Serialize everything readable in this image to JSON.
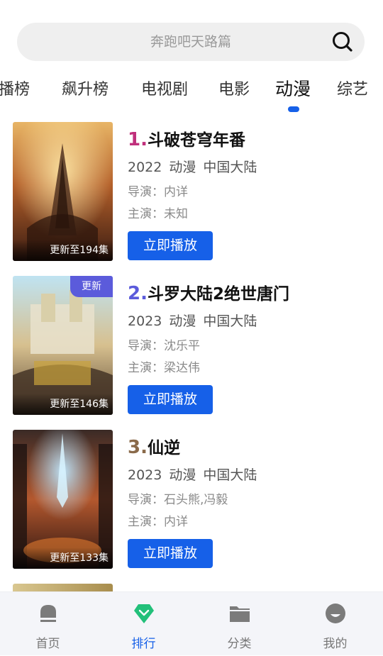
{
  "search": {
    "placeholder": "奔跑吧天路篇",
    "icon": "search-icon"
  },
  "tabs": [
    {
      "label": "播榜",
      "active": false
    },
    {
      "label": "飙升榜",
      "active": false
    },
    {
      "label": "电视剧",
      "active": false
    },
    {
      "label": "电影",
      "active": false
    },
    {
      "label": "动漫",
      "active": true
    },
    {
      "label": "综艺",
      "active": false
    }
  ],
  "colors": {
    "accent": "#1660e8",
    "rank1": "#c0307c",
    "rank2": "#5b5bdb",
    "rank3": "#8a6a4a",
    "badge": "#5b5bdb"
  },
  "items": [
    {
      "rank": "1.",
      "title": "斗破苍穹年番",
      "year": "2022",
      "genre": "动漫",
      "region": "中国大陆",
      "director": "导演：内详",
      "cast": "主演：未知",
      "episodes": "更新至194集",
      "badge": "",
      "play_label": "立即播放"
    },
    {
      "rank": "2.",
      "title": "斗罗大陆2绝世唐门",
      "year": "2023",
      "genre": "动漫",
      "region": "中国大陆",
      "director": "导演：沈乐平",
      "cast": "主演：梁达伟",
      "episodes": "更新至146集",
      "badge": "更新",
      "play_label": "立即播放"
    },
    {
      "rank": "3.",
      "title": "仙逆",
      "year": "2023",
      "genre": "动漫",
      "region": "中国大陆",
      "director": "导演：石头熊,冯毅",
      "cast": "主演：内详",
      "episodes": "更新至133集",
      "badge": "",
      "play_label": "立即播放"
    }
  ],
  "nav": [
    {
      "label": "首页",
      "icon": "home-icon",
      "active": false
    },
    {
      "label": "排行",
      "icon": "ranking-icon",
      "active": true
    },
    {
      "label": "分类",
      "icon": "folder-icon",
      "active": false
    },
    {
      "label": "我的",
      "icon": "profile-icon",
      "active": false
    }
  ]
}
